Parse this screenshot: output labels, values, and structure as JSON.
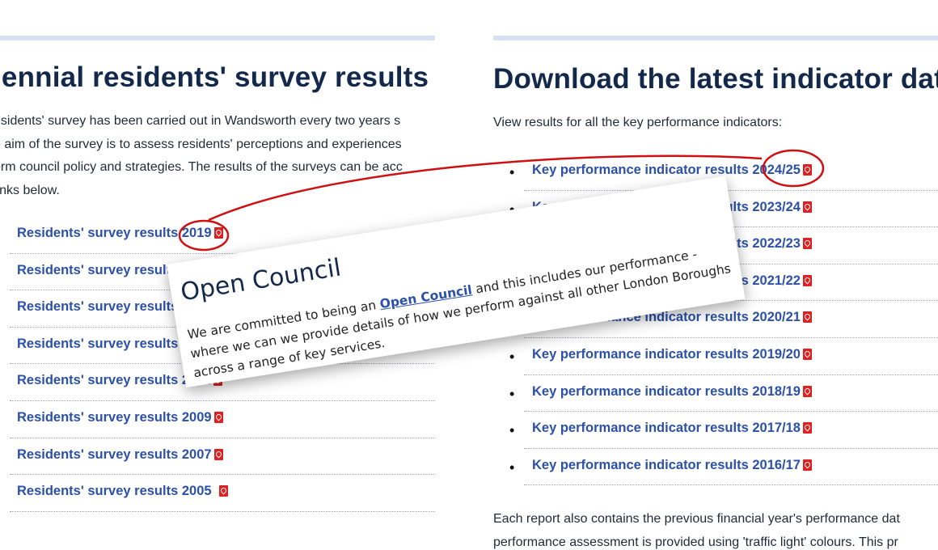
{
  "left": {
    "title": "iennial residents' survey results",
    "paragraph": [
      "esidents' survey has been carried out in Wandsworth every two years s",
      "e aim of the survey is to assess residents' perceptions and experiences",
      "orm council policy and strategies. The results of the surveys can be acc",
      " links below."
    ],
    "links": [
      "Residents' survey results 2019",
      "Residents' survey results 2017",
      "Residents' survey results 2015",
      "Residents' survey results 2013",
      "Residents' survey results 2011",
      "Residents' survey results 2009",
      "Residents' survey results 2007",
      "Residents' survey results 2005"
    ]
  },
  "right": {
    "title": "Download the latest indicator dat",
    "intro": "View results for all the key performance indicators:",
    "links": [
      "Key performance indicator results 2024/25",
      "Key performance indicator results 2023/24",
      "Key performance indicator results 2022/23",
      "Key performance indicator results 2021/22",
      "Key performance indicator results 2020/21",
      "Key performance indicator results 2019/20",
      "Key performance indicator results 2018/19",
      "Key performance indicator results 2017/18",
      "Key performance indicator results 2016/17"
    ],
    "footer": [
      "Each report also contains the previous financial year's performance dat",
      "performance assessment is provided using 'traffic light' colours. This pr"
    ]
  },
  "popup": {
    "title": "Open Council",
    "text_before": "We are committed to being an ",
    "link": "Open Council",
    "text_after": " and this includes our performance - where we can we provide details of how we perform against all other London Boroughs across a range of key services."
  },
  "colors": {
    "link": "#2b50a9",
    "heading": "#13294b",
    "annotation": "#d01010",
    "pdf": "#e02020",
    "rule": "#d6e2f3"
  }
}
